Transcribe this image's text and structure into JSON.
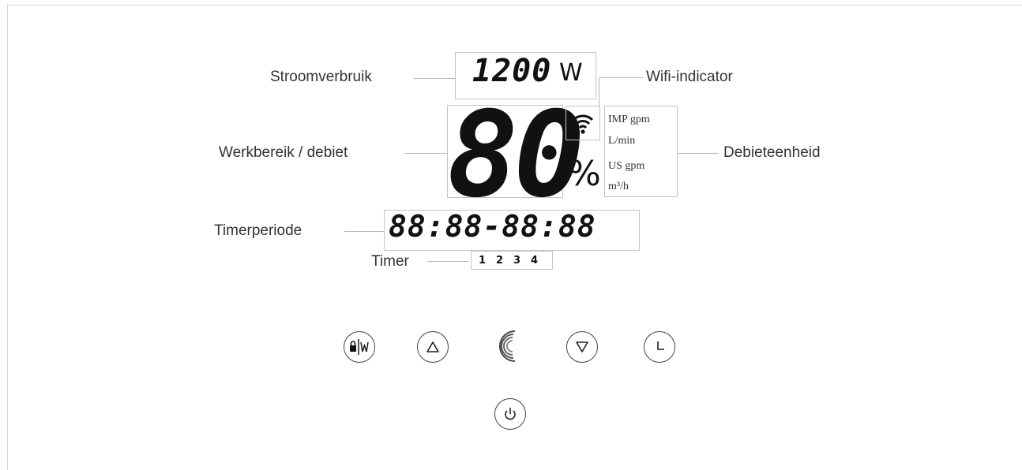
{
  "labels": {
    "power": "Stroomverbruik",
    "wifi": "Wifi-indicator",
    "range": "Werkbereik / debiet",
    "flow_unit": "Debieteenheid",
    "timer_period": "Timerperiode",
    "timer": "Timer"
  },
  "display": {
    "power_value": "1200",
    "power_unit": "W",
    "percent_value": "80",
    "percent_sign": "%",
    "flow_units": [
      "IMP gpm",
      "L/min",
      "US gpm",
      "m³/h"
    ],
    "timer_period": "88:88-88:88",
    "timer_numbers": [
      "1",
      "2",
      "3",
      "4"
    ]
  },
  "buttons": [
    {
      "name": "lock-wifi-button",
      "icon": "lock-w-icon"
    },
    {
      "name": "up-button",
      "icon": "triangle-up-icon"
    },
    {
      "name": "mode-button",
      "icon": "crescent-icon"
    },
    {
      "name": "down-button",
      "icon": "triangle-down-icon"
    },
    {
      "name": "timer-button",
      "icon": "clock-icon"
    },
    {
      "name": "power-button",
      "icon": "power-icon"
    }
  ]
}
